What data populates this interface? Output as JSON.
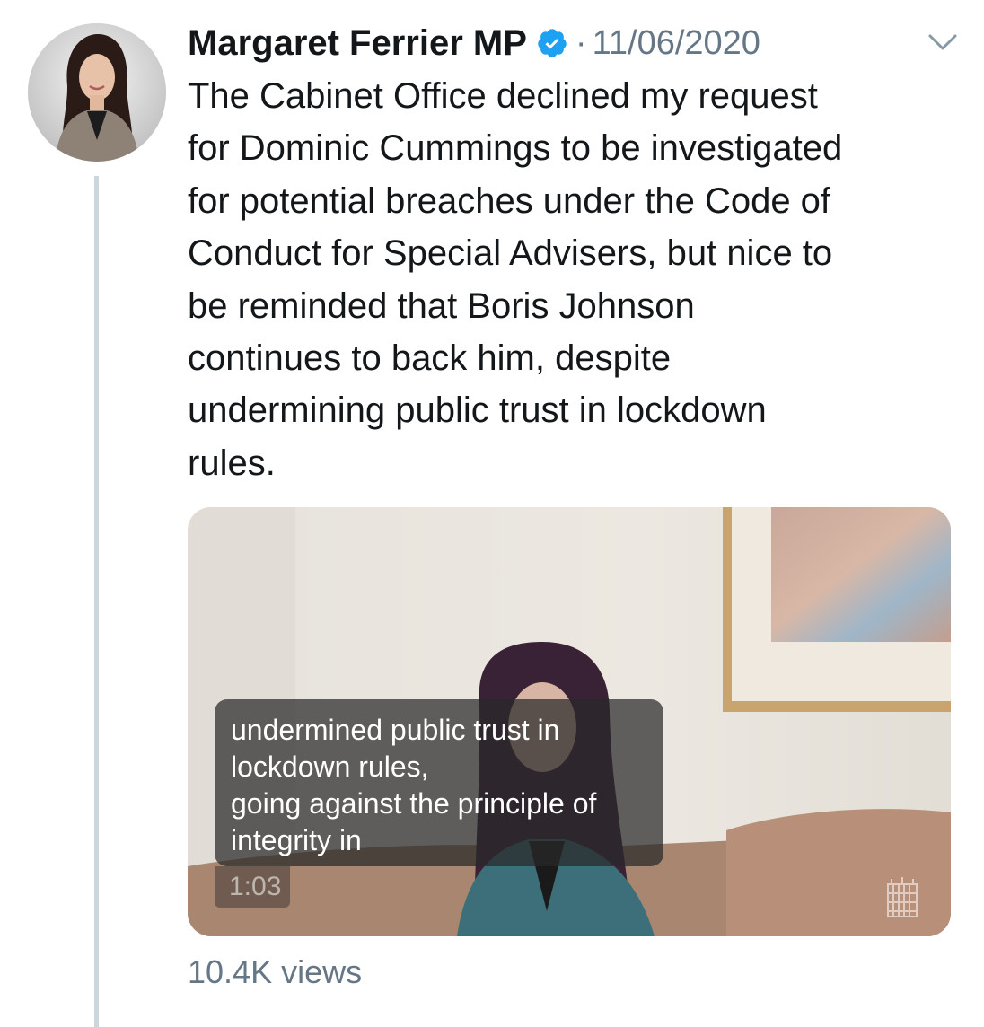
{
  "tweet": {
    "author_name": "Margaret Ferrier MP",
    "verified": true,
    "separator": "·",
    "date": "11/06/2020",
    "text_lines": [
      "The Cabinet Office declined my request",
      "for Dominic Cummings to be investigated",
      "for potential breaches under the Code of",
      "Conduct for Special Advisers, but nice to",
      "be reminded that Boris Johnson",
      "continues to back him, despite",
      "undermining public trust in lockdown",
      "rules."
    ],
    "video": {
      "caption_lines": [
        "undermined public trust in",
        "lockdown rules,",
        "going against the principle of",
        "integrity in"
      ],
      "duration": "1:03",
      "watermark_icon": "portcullis-icon"
    },
    "views": "10.4K views"
  },
  "icons": {
    "verified": "verified-badge-icon",
    "menu": "chevron-down-icon"
  },
  "colors": {
    "text_primary": "#14171a",
    "text_secondary": "#657786",
    "verified_blue": "#1da1f2",
    "thread_line": "#ccd6dd"
  }
}
